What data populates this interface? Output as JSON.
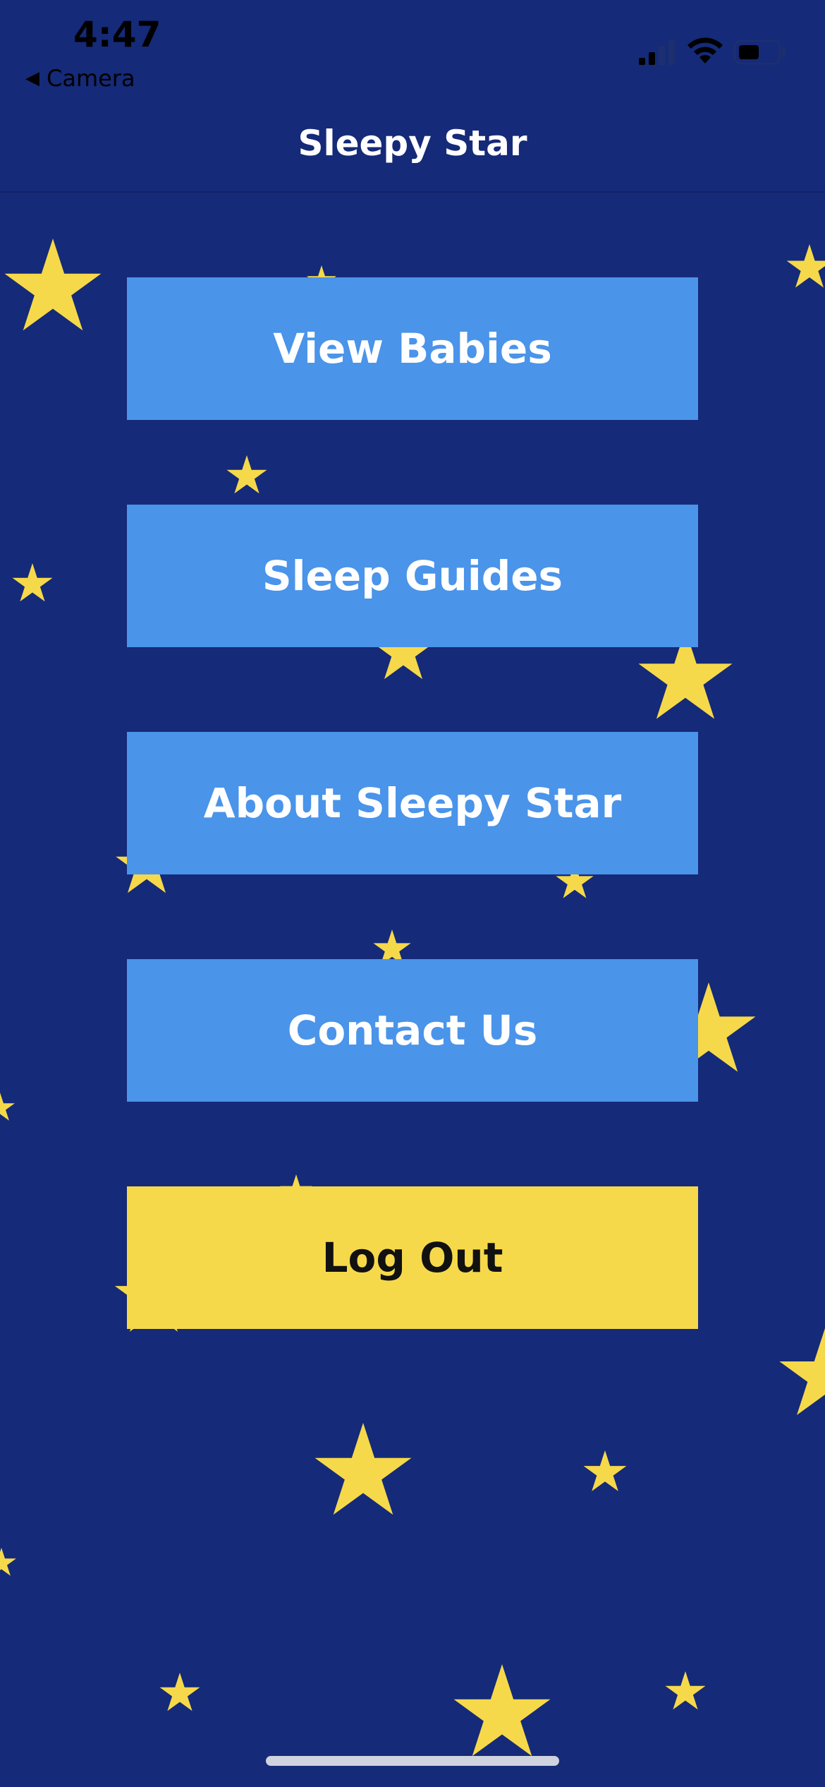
{
  "status_bar": {
    "time": "4:47",
    "back_label": "Camera",
    "back_glyph": "◀"
  },
  "nav": {
    "title": "Sleepy Star"
  },
  "menu": {
    "view_babies": "View Babies",
    "sleep_guides": "Sleep Guides",
    "about": "About Sleepy Star",
    "contact": "Contact Us",
    "log_out": "Log Out"
  },
  "colors": {
    "background": "#152a78",
    "primary_button": "#4a94ea",
    "logout_button": "#f6d94a",
    "star": "#f6d94a"
  },
  "icons": {
    "signal": "cellular-signal-icon",
    "wifi": "wifi-icon",
    "battery": "battery-icon",
    "star": "star-icon"
  }
}
